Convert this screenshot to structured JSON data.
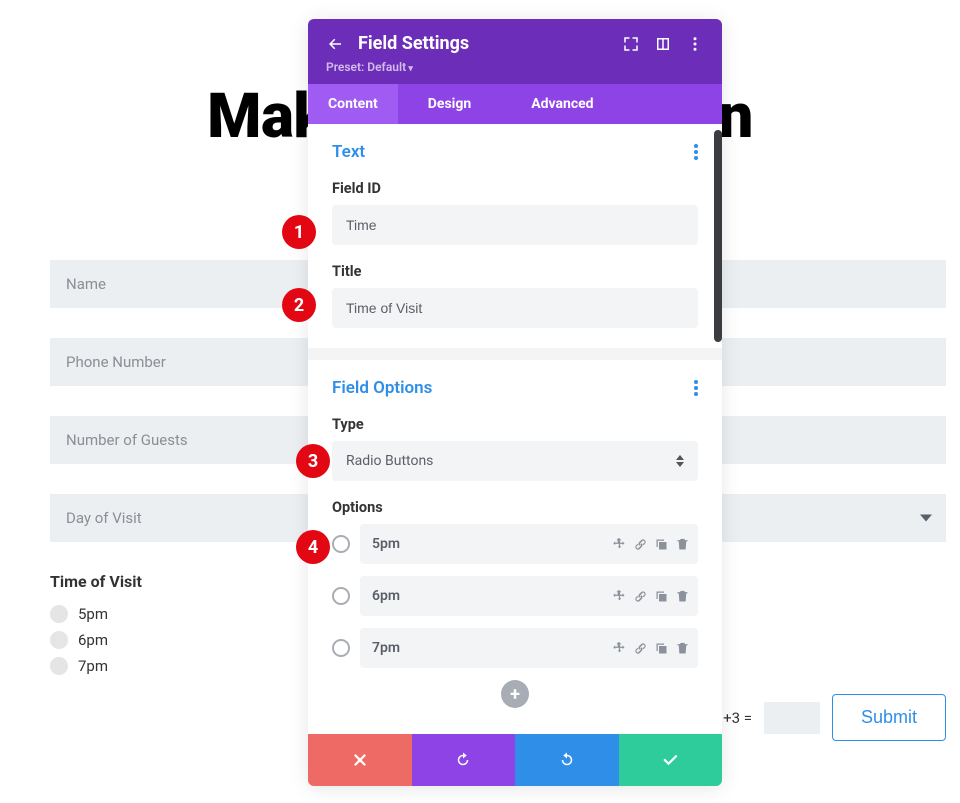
{
  "page": {
    "title": "Make a Reservation",
    "fields": [
      "Name",
      "Phone Number",
      "Number of Guests"
    ],
    "select_label": "Day of Visit",
    "radio_group_label": "Time of Visit",
    "radio_options": [
      "5pm",
      "6pm",
      "7pm"
    ],
    "captcha_label": "12 +3 =",
    "submit_label": "Submit"
  },
  "modal": {
    "title": "Field Settings",
    "preset": "Preset: Default",
    "tabs": {
      "content": "Content",
      "design": "Design",
      "advanced": "Advanced"
    },
    "text_section": {
      "title": "Text",
      "field_id_label": "Field ID",
      "field_id_value": "Time",
      "title_label": "Title",
      "title_value": "Time of Visit"
    },
    "options_section": {
      "title": "Field Options",
      "type_label": "Type",
      "type_value": "Radio Buttons",
      "options_label": "Options",
      "options": [
        "5pm",
        "6pm",
        "7pm"
      ]
    }
  },
  "badges": [
    "1",
    "2",
    "3",
    "4"
  ]
}
